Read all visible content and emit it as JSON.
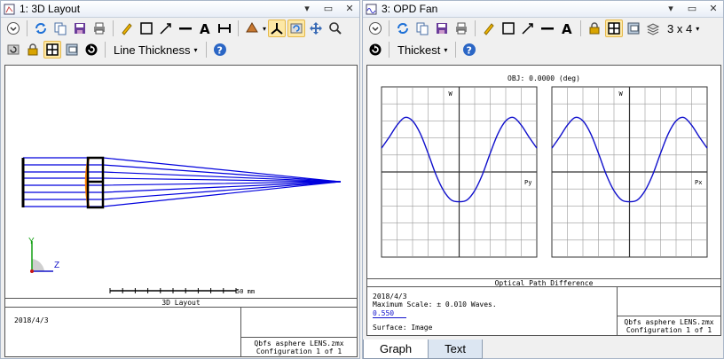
{
  "left_window": {
    "title": "1: 3D Layout",
    "toolbar_dropdown": "Line Thickness",
    "axis_y": "Y",
    "axis_z": "Z",
    "scale_label": "50 mm",
    "panel_title": "3D Layout",
    "date": "2018/4/3",
    "file_name": "Qbfs asphere LENS.zmx",
    "configuration": "Configuration 1 of 1"
  },
  "right_window": {
    "title": "3: OPD Fan",
    "toolbar_dropdown": "Thickest",
    "layout_dropdown": "3 x 4",
    "obj_label": "OBJ: 0.0000 (deg)",
    "left_plot_axis": "Py",
    "right_plot_axis": "Px",
    "left_plot_w": "W",
    "right_plot_w": "W",
    "panel_title": "Optical Path Difference",
    "date": "2018/4/3",
    "max_scale": "Maximum Scale: ± 0.010 Waves.",
    "wavelength": "0.550",
    "surface": "Surface: Image",
    "file_name": "Qbfs asphere LENS.zmx",
    "configuration": "Configuration 1 of 1",
    "tabs": [
      "Graph",
      "Text"
    ]
  },
  "chart_data": [
    {
      "type": "line",
      "title": "OBJ: 0.0000 (deg)",
      "xlabel": "Py",
      "ylabel": "W",
      "xlim": [
        -1,
        1
      ],
      "ylim": [
        -0.01,
        0.01
      ],
      "grid": true,
      "series": [
        {
          "x": [
            -1.0,
            -0.9,
            -0.8,
            -0.7,
            -0.6,
            -0.5,
            -0.4,
            -0.3,
            -0.2,
            -0.1,
            0.0,
            0.1,
            0.2,
            0.3,
            0.4,
            0.5,
            0.6,
            0.7,
            0.8,
            0.9,
            1.0
          ],
          "values": [
            0.0028,
            0.0041,
            0.0055,
            0.0064,
            0.006,
            0.0045,
            0.0022,
            -0.0003,
            -0.0022,
            -0.0033,
            -0.0035,
            -0.0033,
            -0.0022,
            -0.0003,
            0.0022,
            0.0045,
            0.006,
            0.0064,
            0.0055,
            0.0041,
            0.0028
          ]
        }
      ]
    },
    {
      "type": "line",
      "title": "",
      "xlabel": "Px",
      "ylabel": "W",
      "xlim": [
        -1,
        1
      ],
      "ylim": [
        -0.01,
        0.01
      ],
      "grid": true,
      "series": [
        {
          "x": [
            -1.0,
            -0.9,
            -0.8,
            -0.7,
            -0.6,
            -0.5,
            -0.4,
            -0.3,
            -0.2,
            -0.1,
            0.0,
            0.1,
            0.2,
            0.3,
            0.4,
            0.5,
            0.6,
            0.7,
            0.8,
            0.9,
            1.0
          ],
          "values": [
            0.0028,
            0.0041,
            0.0055,
            0.0064,
            0.006,
            0.0045,
            0.0022,
            -0.0003,
            -0.0022,
            -0.0033,
            -0.0035,
            -0.0033,
            -0.0022,
            -0.0003,
            0.0022,
            0.0045,
            0.006,
            0.0064,
            0.0055,
            0.0041,
            0.0028
          ]
        }
      ]
    }
  ],
  "colors": {
    "ray": "#0000dd",
    "lens": "#000000",
    "lens_surface": "#ff7f00",
    "opd_curve": "#1010cc",
    "grid": "#9a9a9a",
    "axis_y": "#14a014",
    "axis_z": "#1414c8",
    "axis_x": "#c81414"
  }
}
